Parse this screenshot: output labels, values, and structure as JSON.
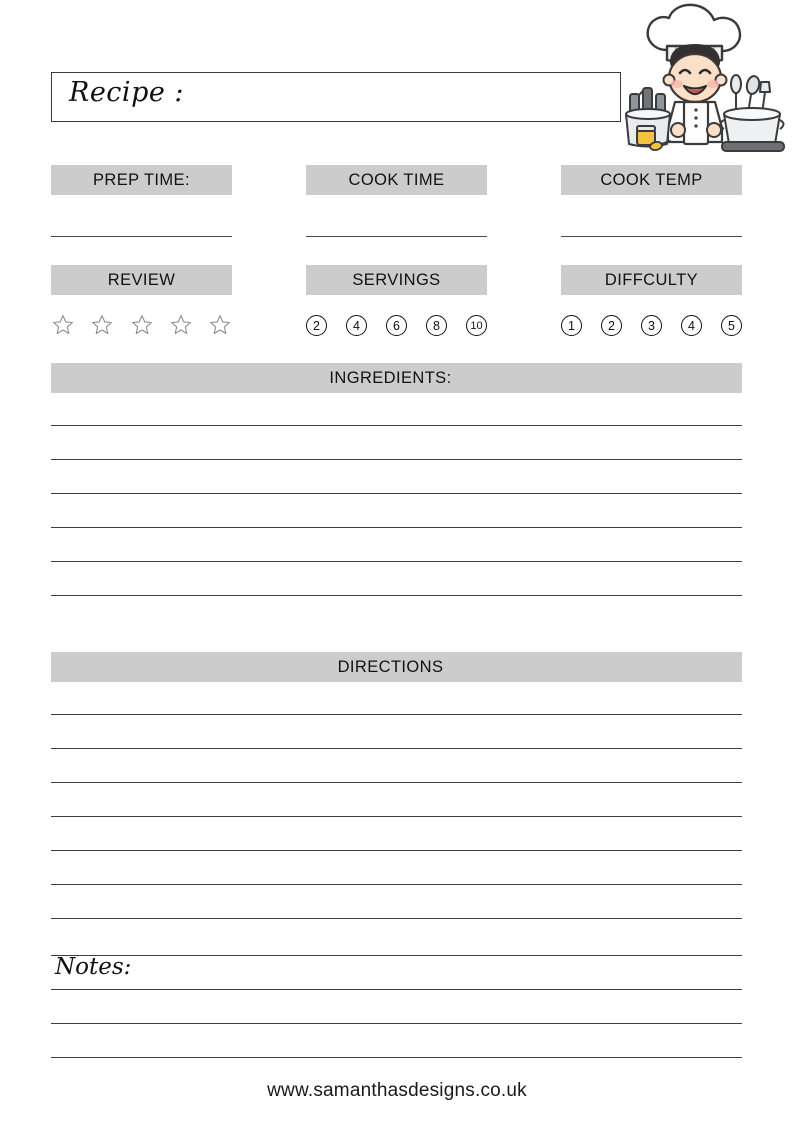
{
  "document": {
    "title_label": "Recipe :",
    "notes_label": "Notes:",
    "footer_url": "www.samanthasdesigns.co.uk"
  },
  "meta_row_1": {
    "prep_time_label": "PREP TIME:",
    "cook_time_label": "COOK TIME",
    "cook_temp_label": "COOK TEMP"
  },
  "meta_row_2": {
    "review_label": "REVIEW",
    "servings_label": "SERVINGS",
    "difficulty_label": "DIFFCULTY"
  },
  "review": {
    "stars": [
      "star-1",
      "star-2",
      "star-3",
      "star-4",
      "star-5"
    ],
    "filled_count": 0
  },
  "servings": {
    "options": [
      "2",
      "4",
      "6",
      "8",
      "10"
    ]
  },
  "difficulty": {
    "options": [
      "1",
      "2",
      "3",
      "4",
      "5"
    ]
  },
  "sections": {
    "ingredients_label": "INGREDIENTS:",
    "directions_label": "DIRECTIONS"
  },
  "lines": {
    "ingredients_line_count": 6,
    "directions_line_count": 7,
    "notes_line_count": 4
  },
  "illustration": {
    "name": "cartoon-chef",
    "description": "smiling cartoon chef boy wearing a white chef hat, holding an apron, with a pot of utensils on each side"
  },
  "colors": {
    "band_gray": "#cccccc",
    "rule_dark": "#3f3f3f",
    "text_black": "#111111",
    "page_background": "#ffffff"
  }
}
